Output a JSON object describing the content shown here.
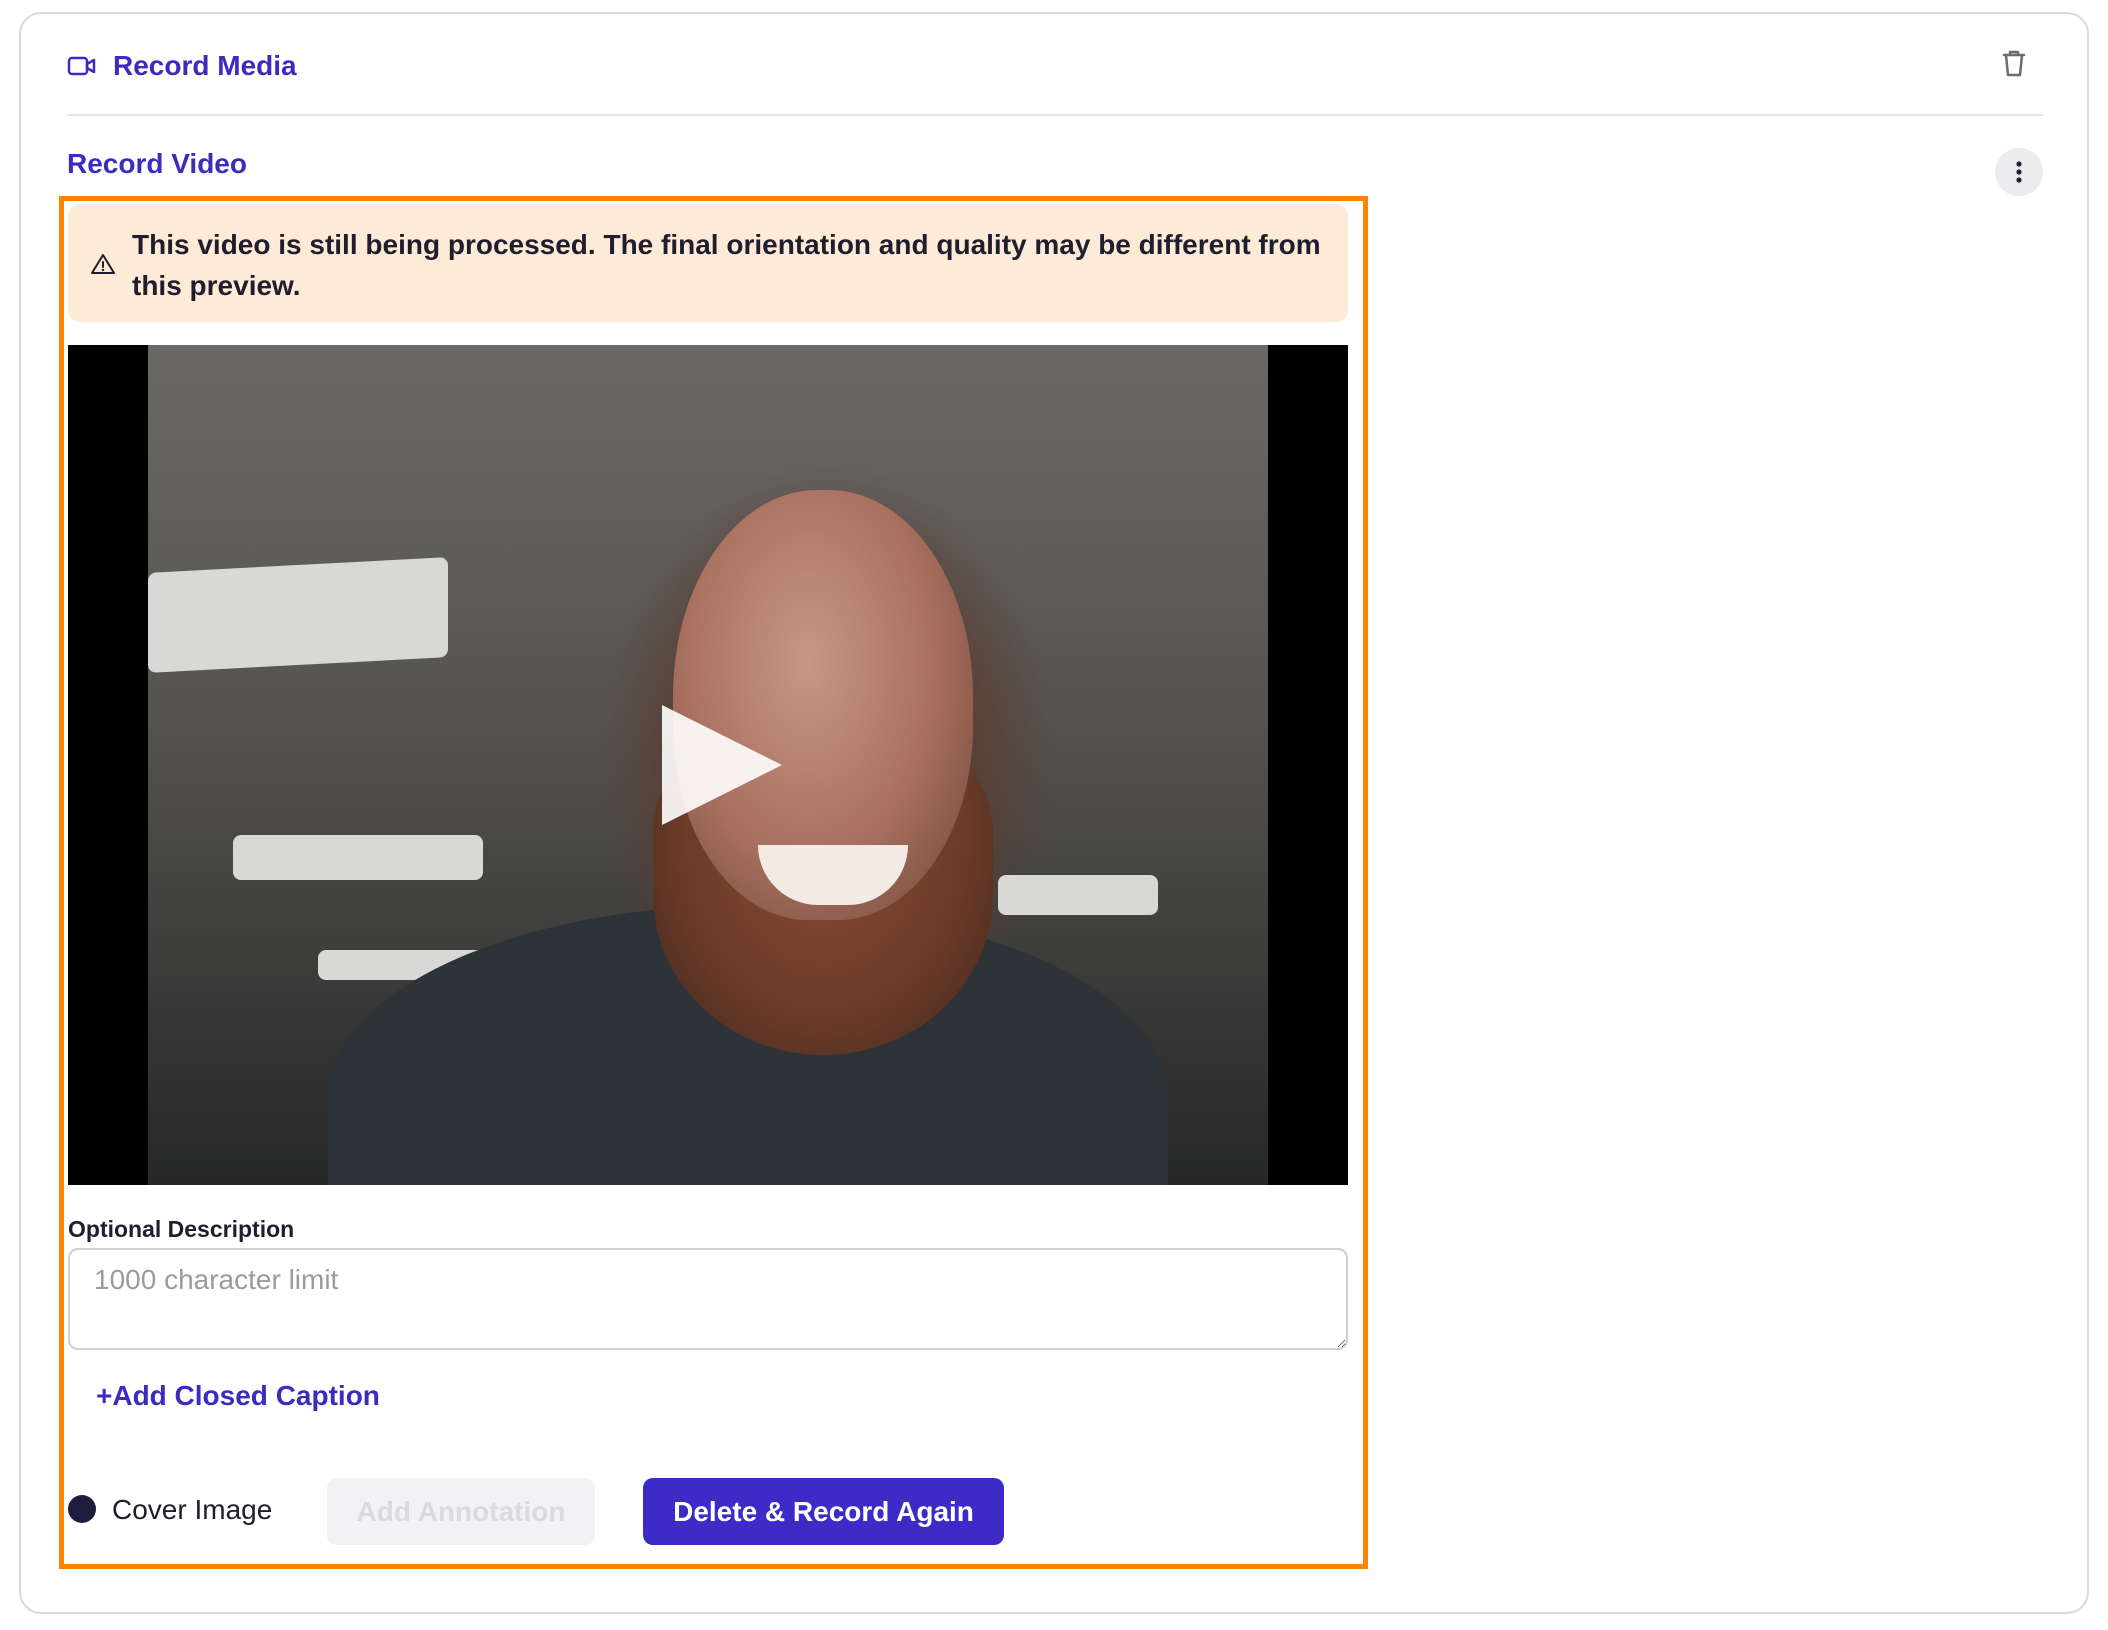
{
  "header": {
    "title": "Record Media",
    "icon": "video-camera-icon"
  },
  "section": {
    "title": "Record Video"
  },
  "warning": {
    "text": "This video is still being processed. The final orientation and quality may be different from this preview."
  },
  "description": {
    "label": "Optional Description",
    "placeholder": "1000 character limit",
    "value": ""
  },
  "closed_caption": {
    "label": "+Add Closed Caption"
  },
  "cover_image": {
    "label": "Cover Image"
  },
  "actions": {
    "annotation_label": "Add Annotation",
    "record_again_label": "Delete & Record Again"
  },
  "colors": {
    "accent": "#3d2bc0",
    "highlight_border": "#ff8200",
    "warning_bg": "#fdebd7",
    "primary_button": "#3d2bc8"
  }
}
